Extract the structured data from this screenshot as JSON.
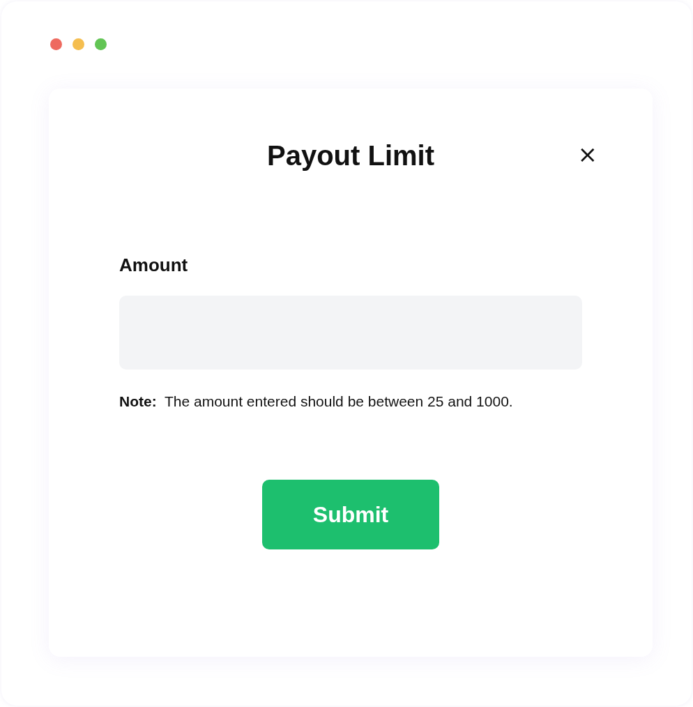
{
  "window": {
    "controls": [
      {
        "color": "#ee6a5f"
      },
      {
        "color": "#f5be4f"
      },
      {
        "color": "#62c554"
      }
    ]
  },
  "dialog": {
    "title": "Payout Limit",
    "close": "×",
    "field": {
      "label": "Amount"
    },
    "note": "**Note:**  The amount entered should be between 25 and 1000.",
    "button": "Submit"
  }
}
